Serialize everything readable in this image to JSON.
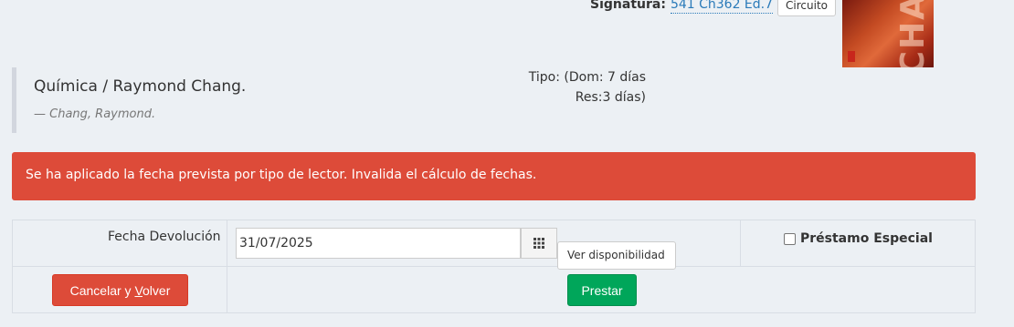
{
  "signature": {
    "label": "Signatura:",
    "value": "541 Ch362 Ed.7",
    "circuit_button": "Circuito"
  },
  "cover": {
    "text": "CHA"
  },
  "book": {
    "title": "Química / Raymond Chang.",
    "author": "— Chang, Raymond."
  },
  "tipo": {
    "line1": "Tipo: (Dom: 7 días",
    "line2": "Res:3 días)"
  },
  "alert": {
    "message": "Se ha aplicado la fecha prevista por tipo de lector. Invalida el cálculo de fechas.",
    "color": "#dd4b39"
  },
  "form": {
    "return_date_label": "Fecha Devolución",
    "return_date_value": "31/07/2025",
    "calendar_icon": "calendar-grid-icon",
    "availability_tooltip": "Ver disponibilidad",
    "special_loan_label": "Préstamo Especial",
    "special_loan_checked": false
  },
  "actions": {
    "cancel_prefix": "Cancelar y ",
    "cancel_underlined": "V",
    "cancel_suffix": "olver",
    "lend": "Prestar",
    "cancel_color": "#dd4b39",
    "lend_color": "#00a65a"
  }
}
